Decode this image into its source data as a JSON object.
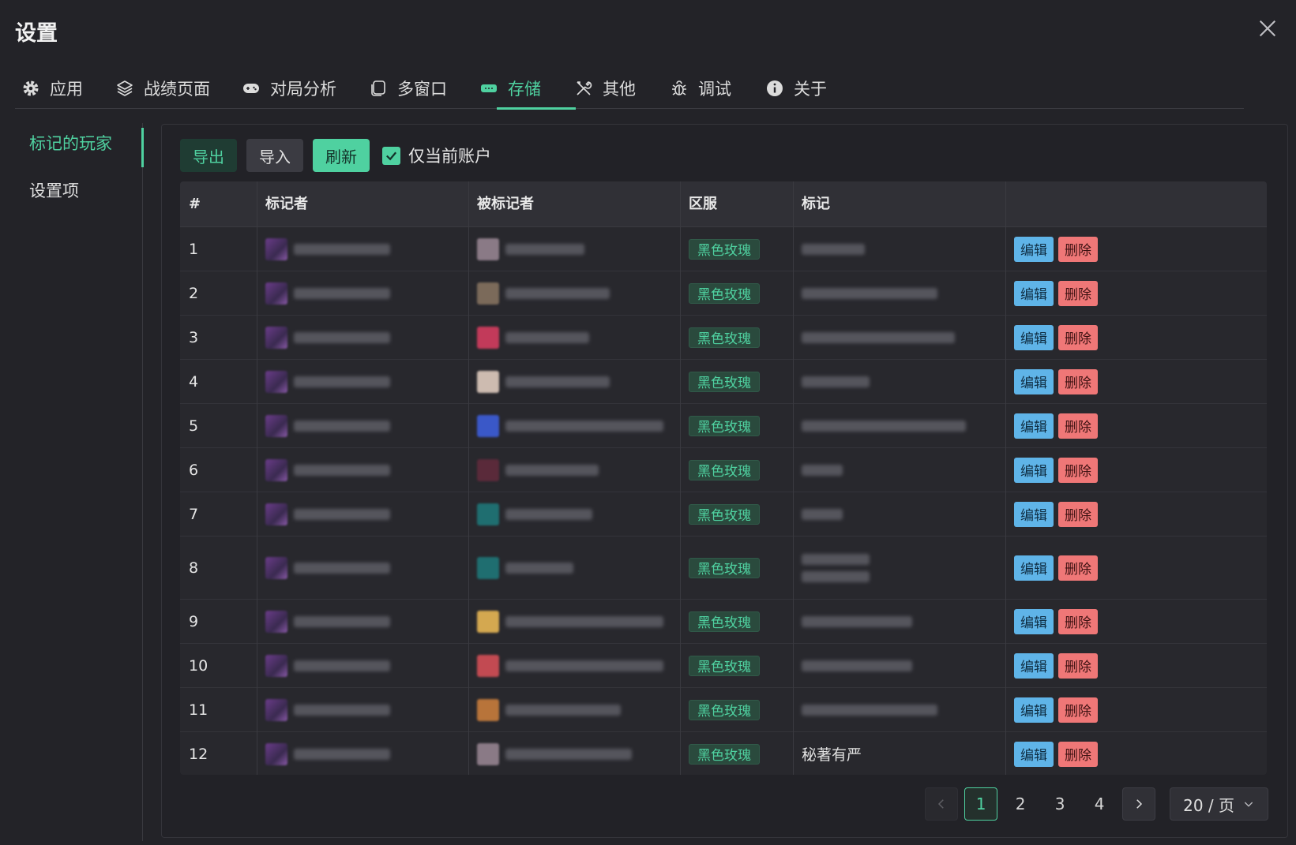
{
  "window": {
    "title": "设置"
  },
  "tabs": [
    {
      "label": "应用",
      "icon": "gear-icon"
    },
    {
      "label": "战绩页面",
      "icon": "layers-icon"
    },
    {
      "label": "对局分析",
      "icon": "gamepad-icon"
    },
    {
      "label": "多窗口",
      "icon": "copy-window-icon"
    },
    {
      "label": "存储",
      "icon": "storage-icon",
      "active": true
    },
    {
      "label": "其他",
      "icon": "tools-icon"
    },
    {
      "label": "调试",
      "icon": "bug-icon"
    },
    {
      "label": "关于",
      "icon": "info-icon"
    }
  ],
  "sidebar": {
    "items": [
      {
        "label": "标记的玩家",
        "active": true
      },
      {
        "label": "设置项",
        "active": false
      }
    ]
  },
  "toolbar": {
    "export_label": "导出",
    "import_label": "导入",
    "refresh_label": "刷新",
    "current_account_only_label": "仅当前账户",
    "current_account_only_checked": true
  },
  "table": {
    "headers": [
      "#",
      "标记者",
      "被标记者",
      "区服",
      "标记",
      ""
    ],
    "edit_label": "编辑",
    "delete_label": "删除",
    "rows": [
      {
        "index": "1",
        "server": "黑色玫瑰"
      },
      {
        "index": "2",
        "server": "黑色玫瑰"
      },
      {
        "index": "3",
        "server": "黑色玫瑰"
      },
      {
        "index": "4",
        "server": "黑色玫瑰"
      },
      {
        "index": "5",
        "server": "黑色玫瑰"
      },
      {
        "index": "6",
        "server": "黑色玫瑰"
      },
      {
        "index": "7",
        "server": "黑色玫瑰"
      },
      {
        "index": "8",
        "server": "黑色玫瑰"
      },
      {
        "index": "9",
        "server": "黑色玫瑰"
      },
      {
        "index": "10",
        "server": "黑色玫瑰"
      },
      {
        "index": "11",
        "server": "黑色玫瑰"
      },
      {
        "index": "12",
        "server": "黑色玫瑰",
        "mark": "秘著有严"
      }
    ]
  },
  "pagination": {
    "pages": [
      "1",
      "2",
      "3",
      "4"
    ],
    "current": "1",
    "page_size_label": "20 / 页"
  },
  "colors": {
    "accent": "#4fd1a0",
    "background": "#232328",
    "edit_button": "#5fb4e8",
    "delete_button": "#ef7777"
  }
}
